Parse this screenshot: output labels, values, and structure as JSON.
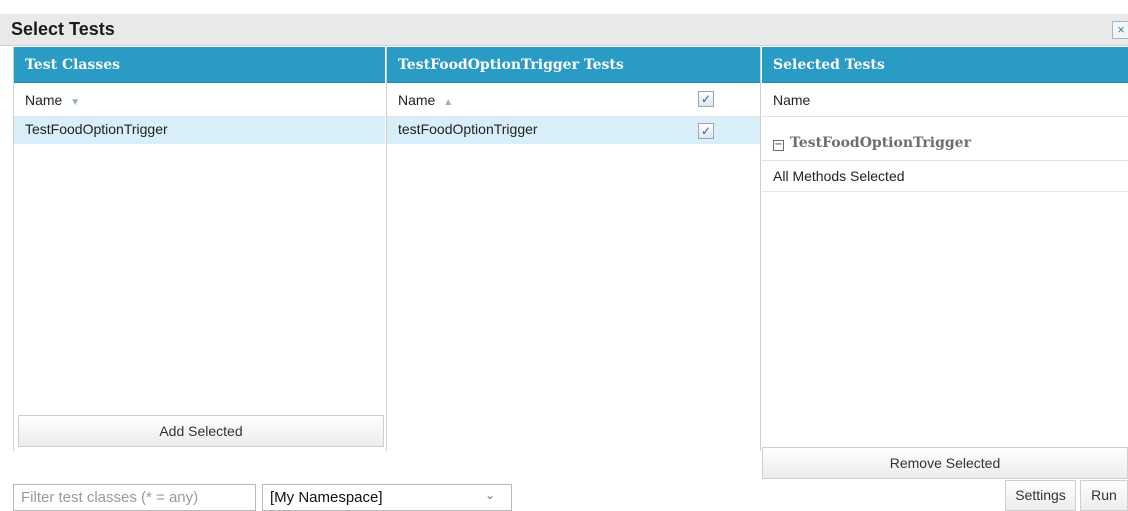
{
  "dialog": {
    "title": "Select Tests",
    "close_glyph": "×"
  },
  "panels": {
    "test_classes": {
      "header": "Test Classes",
      "column": "Name",
      "sort_arrow": "▼",
      "rows": [
        "TestFoodOptionTrigger"
      ],
      "button": "Add Selected"
    },
    "class_tests": {
      "header": "TestFoodOptionTrigger Tests",
      "column": "Name",
      "sort_arrow": "▲",
      "select_all_checked": true,
      "rows": [
        {
          "name": "testFoodOptionTrigger",
          "checked": true
        }
      ]
    },
    "selected_tests": {
      "header": "Selected Tests",
      "column": "Name",
      "group_toggle": "−",
      "group_name": "TestFoodOptionTrigger",
      "group_detail": "All Methods Selected",
      "button": "Remove Selected"
    }
  },
  "bottom": {
    "filter_placeholder": "Filter test classes (* = any)",
    "namespace_value": "[My Namespace]",
    "namespace_dropdown_glyph": "⌄",
    "settings_label": "Settings",
    "run_label": "Run"
  },
  "colors": {
    "header_blue": "#2a9bc4",
    "selected_row": "#d8eef9",
    "title_bar": "#e9e9e9"
  },
  "icons": [
    "close-icon",
    "sort-desc-icon",
    "sort-asc-icon",
    "checkbox-icon",
    "collapse-icon",
    "dropdown-icon"
  ]
}
